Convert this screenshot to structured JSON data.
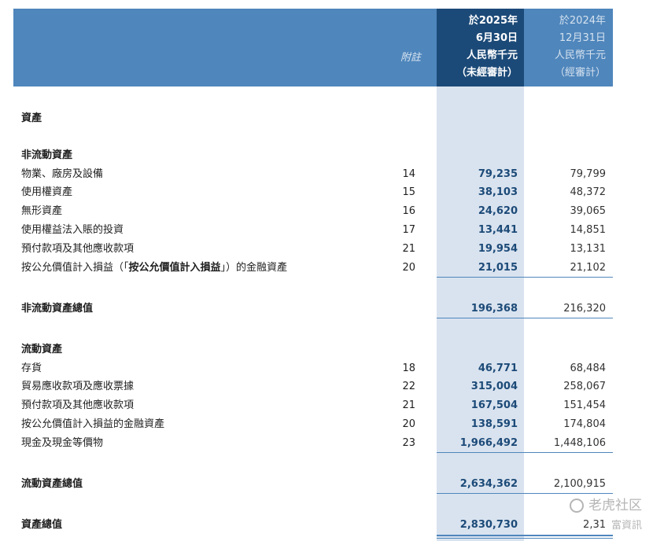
{
  "header": {
    "note_label": "附註",
    "current": [
      "於2025年",
      "6月30日",
      "人民幣千元",
      "（未經審計）"
    ],
    "previous": [
      "於2024年",
      "12月31日",
      "人民幣千元",
      "（經審計）"
    ]
  },
  "rows": [
    {
      "label": "資產",
      "note": "",
      "cur": "",
      "prev": ""
    },
    {
      "label": "非流動資產",
      "note": "",
      "cur": "",
      "prev": ""
    },
    {
      "label": "物業、廠房及設備",
      "note": "14",
      "cur": "79,235",
      "prev": "79,799"
    },
    {
      "label": "使用權資產",
      "note": "15",
      "cur": "38,103",
      "prev": "48,372"
    },
    {
      "label": "無形資產",
      "note": "16",
      "cur": "24,620",
      "prev": "39,065"
    },
    {
      "label": "使用權益法入賬的投資",
      "note": "17",
      "cur": "13,441",
      "prev": "14,851"
    },
    {
      "label": "預付款項及其他應收款項",
      "note": "21",
      "cur": "19,954",
      "prev": "13,131"
    },
    {
      "label_pre": "按公允價值計入損益（「",
      "label_bold": "按公允價值計入損益",
      "label_post": "」）的金融資產",
      "note": "20",
      "cur": "21,015",
      "prev": "21,102"
    },
    {
      "label": "非流動資產總值",
      "note": "",
      "cur": "196,368",
      "prev": "216,320"
    },
    {
      "label": "流動資產",
      "note": "",
      "cur": "",
      "prev": ""
    },
    {
      "label": "存貨",
      "note": "18",
      "cur": "46,771",
      "prev": "68,484"
    },
    {
      "label": "貿易應收款項及應收票據",
      "note": "22",
      "cur": "315,004",
      "prev": "258,067"
    },
    {
      "label": "預付款項及其他應收款項",
      "note": "21",
      "cur": "167,504",
      "prev": "151,454"
    },
    {
      "label": "按公允價值計入損益的金融資產",
      "note": "20",
      "cur": "138,591",
      "prev": "174,804"
    },
    {
      "label": "現金及現金等價物",
      "note": "23",
      "cur": "1,966,492",
      "prev": "1,448,106"
    },
    {
      "label": "流動資產總值",
      "note": "",
      "cur": "2,634,362",
      "prev": "2,100,915"
    },
    {
      "label": "資產總值",
      "note": "",
      "cur": "2,830,730",
      "prev": "2,31"
    }
  ],
  "watermark": {
    "line1": "老虎社区",
    "line2": "富資訊"
  }
}
